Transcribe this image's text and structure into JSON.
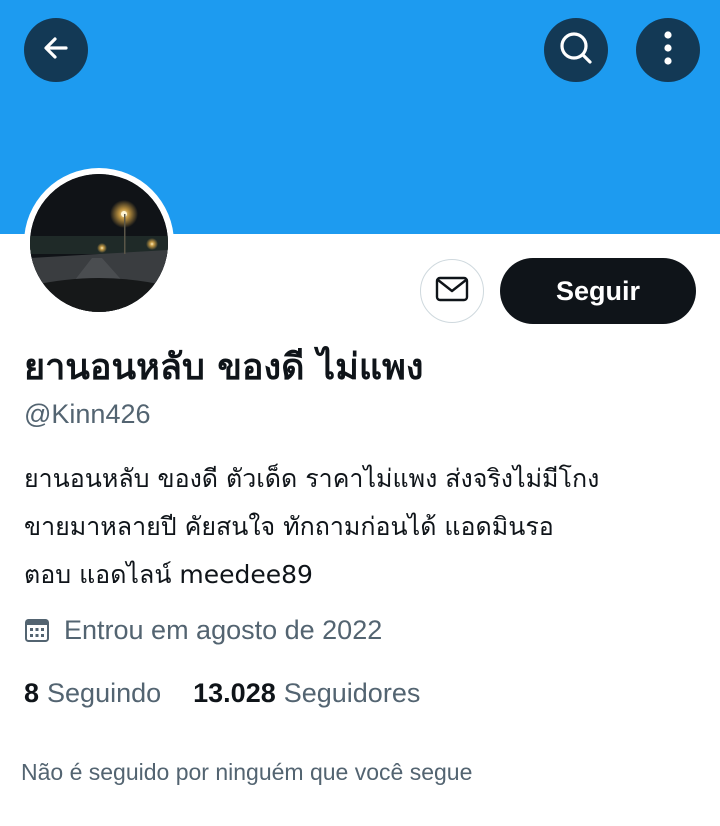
{
  "profile": {
    "display_name": "ยานอนหลับ ของดี ไม่แพง",
    "handle": "@Kinn426",
    "bio_lines": [
      "ยานอนหลับ ของดี ตัวเด็ด ราคาไม่แพง ส่งจริงไม่มีโกง",
      "ขายมาหลายปี  คัยสนใจ ทักถามก่อนได้ แอดมินรอ",
      "ตอบ แอดไลน์ meedee89"
    ],
    "joined": "Entrou em agosto de 2022",
    "following_count": "8",
    "following_label": "Seguindo",
    "followers_count": "13.028",
    "followers_label": "Seguidores",
    "followed_by_note": "Não é seguido por ninguém que você segue"
  },
  "actions": {
    "follow_label": "Seguir"
  },
  "icons": {
    "back": "back-arrow-icon",
    "search": "search-icon",
    "more": "more-vertical-icon",
    "message": "envelope-icon",
    "calendar": "calendar-icon"
  },
  "colors": {
    "banner": "#1d9bf0",
    "follow_button": "#0f1419",
    "secondary_text": "#536471"
  }
}
